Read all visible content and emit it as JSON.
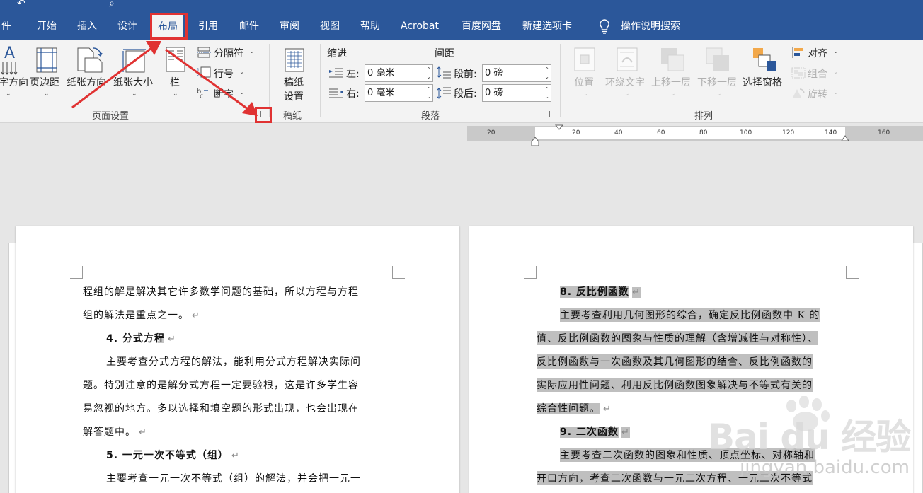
{
  "tabs": [
    {
      "label": "件"
    },
    {
      "label": "开始"
    },
    {
      "label": "插入"
    },
    {
      "label": "设计"
    },
    {
      "label": "布局"
    },
    {
      "label": "引用"
    },
    {
      "label": "邮件"
    },
    {
      "label": "审阅"
    },
    {
      "label": "视图"
    },
    {
      "label": "帮助"
    },
    {
      "label": "Acrobat"
    },
    {
      "label": "百度网盘"
    },
    {
      "label": "新建选项卡"
    }
  ],
  "active_tab": "布局",
  "tell_me": "操作说明搜索",
  "page_setup": {
    "text_direction": "字方向",
    "margins": "页边距",
    "orientation": "纸张方向",
    "size": "纸张大小",
    "columns": "栏",
    "breaks": "分隔符",
    "line_numbers": "行号",
    "hyphenation": "断字",
    "group": "页面设置"
  },
  "draft": {
    "settings_line1": "稿纸",
    "settings_line2": "设置",
    "group": "稿纸"
  },
  "paragraph": {
    "indent_title": "缩进",
    "spacing_title": "间距",
    "left_label": "左:",
    "right_label": "右:",
    "left_value": "0 毫米",
    "right_value": "0 毫米",
    "before_label": "段前:",
    "after_label": "段后:",
    "before_value": "0 磅",
    "after_value": "0 磅",
    "group": "段落"
  },
  "arrange": {
    "position": "位置",
    "wrap_text": "环绕文字",
    "bring_forward": "上移一层",
    "send_backward": "下移一层",
    "selection_pane": "选择窗格",
    "align": "对齐",
    "group_cmd": "组合",
    "rotate": "旋转",
    "group": "排列"
  },
  "ruler": {
    "numbers": [
      "20",
      "20",
      "40",
      "60",
      "80",
      "100",
      "120",
      "140",
      "160"
    ]
  },
  "left_page": [
    "程组的解是解决其它许多数学问题的基础，所以方程与方程",
    "组的解法是重点之一。",
    "4. 分式方程",
    "主要考查分式方程的解法，能利用分式方程解决实际问",
    "题。特别注意的是解分式方程一定要验根，这是许多学生容",
    "易忽视的地方。多以选择和填空题的形式出现，也会出现在",
    "解答题中。",
    "5. 一元一次不等式（组）",
    "主要考查一元一次不等式（组）的解法，并会把一元一"
  ],
  "right_page": [
    "8. 反比例函数",
    "主要考查利用几何图形的综合，确定反比例函数中 K 的",
    "值、反比例函数的图象与性质的理解（含增减性与对称性）、",
    "反比例函数与一次函数及其几何图形的结合、反比例函数的",
    "实际应用性问题、利用反比例函数图象解决与不等式有关的",
    "综合性问题。",
    "9. 二次函数",
    "主要考查二次函数的图象和性质、顶点坐标、对称轴和",
    "开口方向，考查二次函数与一元二次方程、一元二次不等式"
  ],
  "paragraph_mark": "↵",
  "watermark": {
    "brand": "Bai du 经验",
    "site": "jingyan.baidu.com"
  },
  "colors": {
    "title_bar": "#2b579a",
    "ribbon": "#f3f3f3",
    "highlight_box": "#e03232",
    "selection": "#bfbfbf"
  }
}
